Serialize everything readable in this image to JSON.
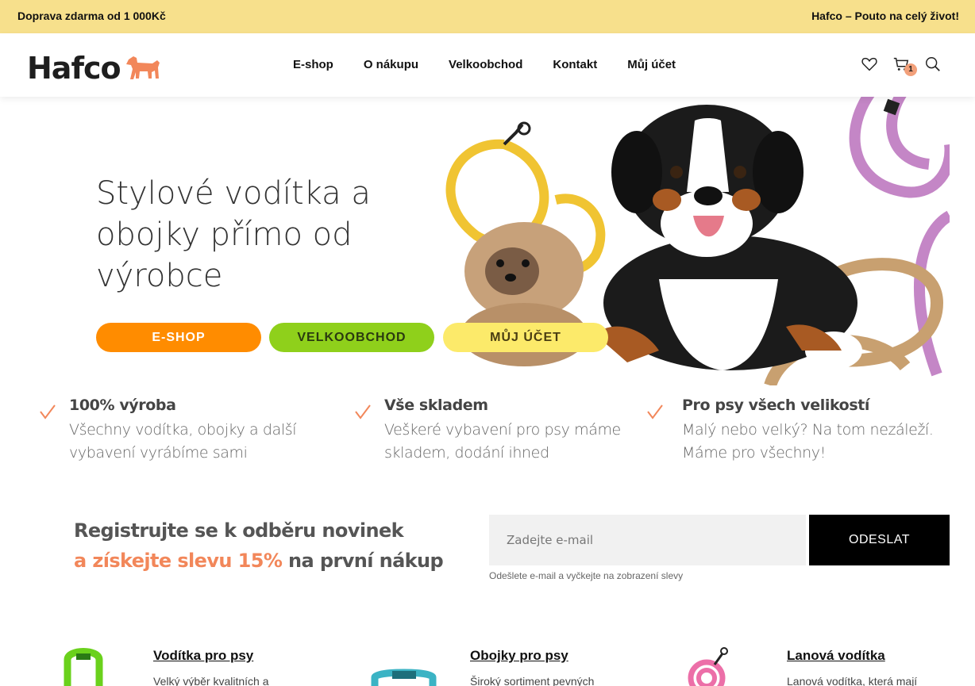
{
  "topbar": {
    "left_text": "Doprava zdarma od 1 000Kč",
    "right_text": "Hafco – Pouto na celý život!"
  },
  "header": {
    "logo_text": "Hafco",
    "nav": [
      "E-shop",
      "O nákupu",
      "Velkoobchod",
      "Kontakt",
      "Můj účet"
    ],
    "cart_count": "1"
  },
  "hero": {
    "headline_lines": [
      "Stylové vodítka a",
      "obojky přímo od",
      "výrobce"
    ],
    "buttons": {
      "eshop": "E-SHOP",
      "velkoobchod": "VELKOOBCHOD",
      "ucet": "MŮJ ÚČET"
    },
    "colors": {
      "eshop": "#ff8c00",
      "velkoobchod": "#8fd01b",
      "ucet": "#fcea6a"
    }
  },
  "features": [
    {
      "title": "100% výroba",
      "text": "Všechny vodítka, obojky a další vybavení vyrábíme sami"
    },
    {
      "title": "Vše skladem",
      "text": "Veškeré vybavení pro psy máme skladem, dodání ihned"
    },
    {
      "title": "Pro psy všech velikostí",
      "text": "Malý nebo velký? Na tom nezáleží. Máme pro všechny!"
    }
  ],
  "newsletter": {
    "title_line1": "Registrujte se k odběru novinek",
    "title_accent": "a získejte slevu 15%",
    "title_rest": " na první nákup",
    "input_placeholder": "Zadejte e-mail",
    "button_label": "ODESLAT",
    "note": "Odešlete e-mail a vyčkejte na zobrazení slevy",
    "accent_color": "#f2875a"
  },
  "categories": [
    {
      "title": "Vodítka pro psy",
      "text": "Velký výběr kvalitních a"
    },
    {
      "title": "Obojky pro psy",
      "text": "Široký sortiment pevných"
    },
    {
      "title": "Lanová vodítka",
      "text": "Lanová vodítka, která mají"
    }
  ]
}
